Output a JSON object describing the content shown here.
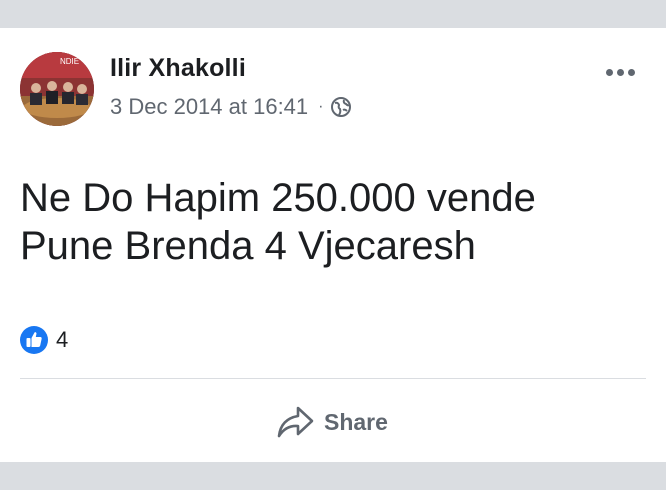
{
  "post": {
    "author": "Ilir Xhakolli",
    "timestamp": "3 Dec 2014 at 16:41",
    "separator": "·",
    "privacy_icon": "globe-icon",
    "more_icon": "more-options-icon",
    "text_line1": "Ne Do Hapim 250.000 vende",
    "text_line2": "Pune Brenda 4 Vjecaresh",
    "avatar_banner_text": "NDIE",
    "reactions": {
      "icon": "like-icon",
      "count": "4"
    },
    "share_label": "Share"
  },
  "colors": {
    "band": "#dadde1",
    "text_primary": "#1c1e21",
    "text_secondary": "#606770",
    "like_blue": "#1877f2"
  }
}
